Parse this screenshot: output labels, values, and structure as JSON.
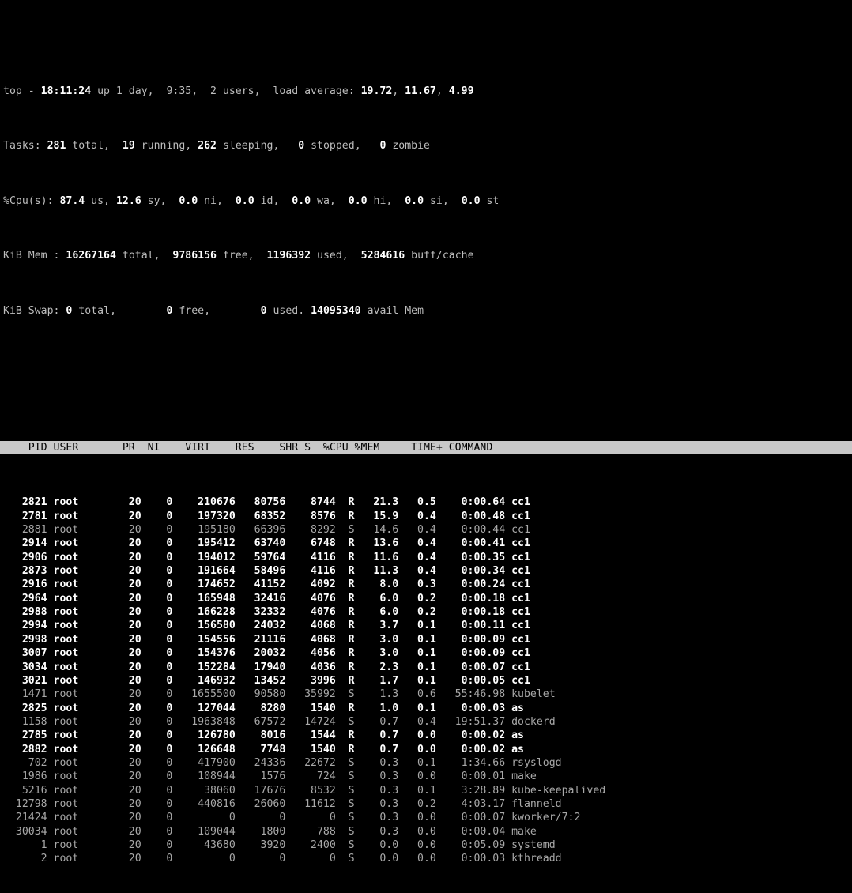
{
  "terminal": {
    "program": "top",
    "background_color": "#000000",
    "foreground_color": "#bdbdbd",
    "header_bar_color": "#c8c8c8",
    "header_text_color": "#000000"
  },
  "summary": {
    "line1": {
      "label": "top - ",
      "time": "18:11:24",
      "uptime_text": " up 1 day,  9:35,  2 users,  load average: ",
      "load_1": "19.72",
      "load_5": "11.67",
      "load_15": "4.99",
      "full": "top - 18:11:24 up 1 day,  9:35,  2 users,  load average: 19.72, 11.67, 4.99"
    },
    "tasks": {
      "label": "Tasks: ",
      "total": "281",
      "total_label": " total,  ",
      "running": "19",
      "running_label": " running, ",
      "sleeping": "262",
      "sleeping_label": " sleeping,   ",
      "stopped": "0",
      "stopped_label": " stopped,   ",
      "zombie": "0",
      "zombie_label": " zombie"
    },
    "cpu": {
      "label": "%Cpu(s): ",
      "us": "87.4",
      "us_label": " us, ",
      "sy": "12.6",
      "sy_label": " sy,  ",
      "ni": "0.0",
      "ni_label": " ni,  ",
      "id": "0.0",
      "id_label": " id,  ",
      "wa": "0.0",
      "wa_label": " wa,  ",
      "hi": "0.0",
      "hi_label": " hi,  ",
      "si": "0.0",
      "si_label": " si,  ",
      "st": "0.0",
      "st_label": " st"
    },
    "mem": {
      "label": "KiB Mem : ",
      "total": "16267164",
      "total_label": " total,  ",
      "free": "9786156",
      "free_label": " free,  ",
      "used": "1196392",
      "used_label": " used,  ",
      "buff_cache": "5284616",
      "buff_cache_label": " buff/cache"
    },
    "swap": {
      "label": "KiB Swap: ",
      "total": "0",
      "total_label": " total,        ",
      "free": "0",
      "free_label": " free,        ",
      "used": "0",
      "used_label": " used. ",
      "avail": "14095340",
      "avail_label": " avail Mem"
    }
  },
  "table": {
    "columns": [
      {
        "key": "pid",
        "label": "PID",
        "width": 7,
        "align": "right"
      },
      {
        "key": "user",
        "label": "USER",
        "width": 9,
        "align": "left"
      },
      {
        "key": "pr",
        "label": "PR",
        "width": 4,
        "align": "right"
      },
      {
        "key": "ni",
        "label": "NI",
        "width": 4,
        "align": "right"
      },
      {
        "key": "virt",
        "label": "VIRT",
        "width": 9,
        "align": "right"
      },
      {
        "key": "res",
        "label": "RES",
        "width": 7,
        "align": "right"
      },
      {
        "key": "shr",
        "label": "SHR",
        "width": 7,
        "align": "right"
      },
      {
        "key": "s",
        "label": "S",
        "width": 2,
        "align": "right"
      },
      {
        "key": "cpu",
        "label": "%CPU",
        "width": 6,
        "align": "right"
      },
      {
        "key": "mem",
        "label": "%MEM",
        "width": 5,
        "align": "right"
      },
      {
        "key": "time",
        "label": "TIME+",
        "width": 10,
        "align": "right"
      },
      {
        "key": "command",
        "label": "COMMAND",
        "width": 0,
        "align": "left"
      }
    ],
    "header_line": "    PID USER       PR  NI    VIRT    RES    SHR S  %CPU %MEM     TIME+ COMMAND                                                                              ",
    "rows": [
      {
        "pid": "2821",
        "user": "root",
        "pr": "20",
        "ni": "0",
        "virt": "210676",
        "res": "80756",
        "shr": "8744",
        "s": "R",
        "cpu": "21.3",
        "mem": "0.5",
        "time": "0:00.64",
        "command": "cc1"
      },
      {
        "pid": "2781",
        "user": "root",
        "pr": "20",
        "ni": "0",
        "virt": "197320",
        "res": "68352",
        "shr": "8576",
        "s": "R",
        "cpu": "15.9",
        "mem": "0.4",
        "time": "0:00.48",
        "command": "cc1"
      },
      {
        "pid": "2881",
        "user": "root",
        "pr": "20",
        "ni": "0",
        "virt": "195180",
        "res": "66396",
        "shr": "8292",
        "s": "S",
        "cpu": "14.6",
        "mem": "0.4",
        "time": "0:00.44",
        "command": "cc1"
      },
      {
        "pid": "2914",
        "user": "root",
        "pr": "20",
        "ni": "0",
        "virt": "195412",
        "res": "63740",
        "shr": "6748",
        "s": "R",
        "cpu": "13.6",
        "mem": "0.4",
        "time": "0:00.41",
        "command": "cc1"
      },
      {
        "pid": "2906",
        "user": "root",
        "pr": "20",
        "ni": "0",
        "virt": "194012",
        "res": "59764",
        "shr": "4116",
        "s": "R",
        "cpu": "11.6",
        "mem": "0.4",
        "time": "0:00.35",
        "command": "cc1"
      },
      {
        "pid": "2873",
        "user": "root",
        "pr": "20",
        "ni": "0",
        "virt": "191664",
        "res": "58496",
        "shr": "4116",
        "s": "R",
        "cpu": "11.3",
        "mem": "0.4",
        "time": "0:00.34",
        "command": "cc1"
      },
      {
        "pid": "2916",
        "user": "root",
        "pr": "20",
        "ni": "0",
        "virt": "174652",
        "res": "41152",
        "shr": "4092",
        "s": "R",
        "cpu": "8.0",
        "mem": "0.3",
        "time": "0:00.24",
        "command": "cc1"
      },
      {
        "pid": "2964",
        "user": "root",
        "pr": "20",
        "ni": "0",
        "virt": "165948",
        "res": "32416",
        "shr": "4076",
        "s": "R",
        "cpu": "6.0",
        "mem": "0.2",
        "time": "0:00.18",
        "command": "cc1"
      },
      {
        "pid": "2988",
        "user": "root",
        "pr": "20",
        "ni": "0",
        "virt": "166228",
        "res": "32332",
        "shr": "4076",
        "s": "R",
        "cpu": "6.0",
        "mem": "0.2",
        "time": "0:00.18",
        "command": "cc1"
      },
      {
        "pid": "2994",
        "user": "root",
        "pr": "20",
        "ni": "0",
        "virt": "156580",
        "res": "24032",
        "shr": "4068",
        "s": "R",
        "cpu": "3.7",
        "mem": "0.1",
        "time": "0:00.11",
        "command": "cc1"
      },
      {
        "pid": "2998",
        "user": "root",
        "pr": "20",
        "ni": "0",
        "virt": "154556",
        "res": "21116",
        "shr": "4068",
        "s": "R",
        "cpu": "3.0",
        "mem": "0.1",
        "time": "0:00.09",
        "command": "cc1"
      },
      {
        "pid": "3007",
        "user": "root",
        "pr": "20",
        "ni": "0",
        "virt": "154376",
        "res": "20032",
        "shr": "4056",
        "s": "R",
        "cpu": "3.0",
        "mem": "0.1",
        "time": "0:00.09",
        "command": "cc1"
      },
      {
        "pid": "3034",
        "user": "root",
        "pr": "20",
        "ni": "0",
        "virt": "152284",
        "res": "17940",
        "shr": "4036",
        "s": "R",
        "cpu": "2.3",
        "mem": "0.1",
        "time": "0:00.07",
        "command": "cc1"
      },
      {
        "pid": "3021",
        "user": "root",
        "pr": "20",
        "ni": "0",
        "virt": "146932",
        "res": "13452",
        "shr": "3996",
        "s": "R",
        "cpu": "1.7",
        "mem": "0.1",
        "time": "0:00.05",
        "command": "cc1"
      },
      {
        "pid": "1471",
        "user": "root",
        "pr": "20",
        "ni": "0",
        "virt": "1655500",
        "res": "90580",
        "shr": "35992",
        "s": "S",
        "cpu": "1.3",
        "mem": "0.6",
        "time": "55:46.98",
        "command": "kubelet"
      },
      {
        "pid": "2825",
        "user": "root",
        "pr": "20",
        "ni": "0",
        "virt": "127044",
        "res": "8280",
        "shr": "1540",
        "s": "R",
        "cpu": "1.0",
        "mem": "0.1",
        "time": "0:00.03",
        "command": "as"
      },
      {
        "pid": "1158",
        "user": "root",
        "pr": "20",
        "ni": "0",
        "virt": "1963848",
        "res": "67572",
        "shr": "14724",
        "s": "S",
        "cpu": "0.7",
        "mem": "0.4",
        "time": "19:51.37",
        "command": "dockerd"
      },
      {
        "pid": "2785",
        "user": "root",
        "pr": "20",
        "ni": "0",
        "virt": "126780",
        "res": "8016",
        "shr": "1544",
        "s": "R",
        "cpu": "0.7",
        "mem": "0.0",
        "time": "0:00.02",
        "command": "as"
      },
      {
        "pid": "2882",
        "user": "root",
        "pr": "20",
        "ni": "0",
        "virt": "126648",
        "res": "7748",
        "shr": "1540",
        "s": "R",
        "cpu": "0.7",
        "mem": "0.0",
        "time": "0:00.02",
        "command": "as"
      },
      {
        "pid": "702",
        "user": "root",
        "pr": "20",
        "ni": "0",
        "virt": "417900",
        "res": "24336",
        "shr": "22672",
        "s": "S",
        "cpu": "0.3",
        "mem": "0.1",
        "time": "1:34.66",
        "command": "rsyslogd"
      },
      {
        "pid": "1986",
        "user": "root",
        "pr": "20",
        "ni": "0",
        "virt": "108944",
        "res": "1576",
        "shr": "724",
        "s": "S",
        "cpu": "0.3",
        "mem": "0.0",
        "time": "0:00.01",
        "command": "make"
      },
      {
        "pid": "5216",
        "user": "root",
        "pr": "20",
        "ni": "0",
        "virt": "38060",
        "res": "17676",
        "shr": "8532",
        "s": "S",
        "cpu": "0.3",
        "mem": "0.1",
        "time": "3:28.89",
        "command": "kube-keepalived"
      },
      {
        "pid": "12798",
        "user": "root",
        "pr": "20",
        "ni": "0",
        "virt": "440816",
        "res": "26060",
        "shr": "11612",
        "s": "S",
        "cpu": "0.3",
        "mem": "0.2",
        "time": "4:03.17",
        "command": "flanneld"
      },
      {
        "pid": "21424",
        "user": "root",
        "pr": "20",
        "ni": "0",
        "virt": "0",
        "res": "0",
        "shr": "0",
        "s": "S",
        "cpu": "0.3",
        "mem": "0.0",
        "time": "0:00.07",
        "command": "kworker/7:2"
      },
      {
        "pid": "30034",
        "user": "root",
        "pr": "20",
        "ni": "0",
        "virt": "109044",
        "res": "1800",
        "shr": "788",
        "s": "S",
        "cpu": "0.3",
        "mem": "0.0",
        "time": "0:00.04",
        "command": "make"
      },
      {
        "pid": "1",
        "user": "root",
        "pr": "20",
        "ni": "0",
        "virt": "43680",
        "res": "3920",
        "shr": "2400",
        "s": "S",
        "cpu": "0.0",
        "mem": "0.0",
        "time": "0:05.09",
        "command": "systemd"
      },
      {
        "pid": "2",
        "user": "root",
        "pr": "20",
        "ni": "0",
        "virt": "0",
        "res": "0",
        "shr": "0",
        "s": "S",
        "cpu": "0.0",
        "mem": "0.0",
        "time": "0:00.03",
        "command": "kthreadd"
      }
    ]
  }
}
